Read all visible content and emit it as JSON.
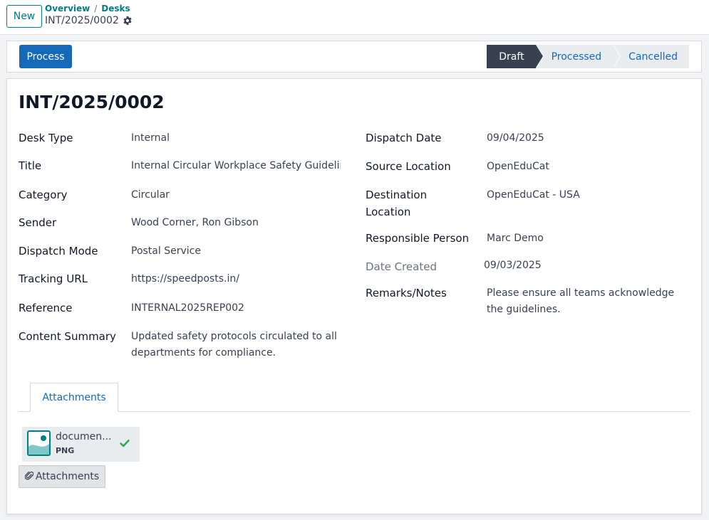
{
  "header": {
    "new_label": "New",
    "breadcrumbs": [
      "Overview",
      "Desks"
    ],
    "record_name": "INT/2025/0002"
  },
  "statusbar": {
    "process_label": "Process",
    "stages": [
      "Draft",
      "Processed",
      "Cancelled"
    ],
    "current_stage": "Draft"
  },
  "form": {
    "title": "INT/2025/0002",
    "left": [
      {
        "label": "Desk Type",
        "value": "Internal"
      },
      {
        "label": "Title",
        "value": "Internal Circular  Workplace Safety Guidelir"
      },
      {
        "label": "Category",
        "value": "Circular"
      },
      {
        "label": "Sender",
        "value": "Wood Corner, Ron Gibson"
      },
      {
        "label": "Dispatch Mode",
        "value": "Postal Service"
      },
      {
        "label": "Tracking URL",
        "value": "https://speedposts.in/"
      },
      {
        "label": "Reference",
        "value": "INTERNAL2025REP002"
      },
      {
        "label": "Content Summary",
        "value_lines": [
          "Updated safety protocols circulated to all",
          "departments for compliance."
        ]
      }
    ],
    "right": [
      {
        "label": "Dispatch Date",
        "value": "09/04/2025"
      },
      {
        "label": "Source Location",
        "value": "OpenEduCat"
      },
      {
        "label_lines": [
          "Destination",
          "Location"
        ],
        "value": "OpenEduCat - USA"
      },
      {
        "label": "Responsible Person",
        "value": "Marc Demo"
      },
      {
        "label": "Date Created",
        "value": "09/03/2025"
      },
      {
        "label": "Remarks/Notes",
        "value_lines": [
          "Please ensure all teams acknowledge",
          "the guidelines."
        ]
      }
    ]
  },
  "tabs": {
    "attachments_label": "Attachments"
  },
  "attachment": {
    "name": "documen...",
    "ext": "PNG"
  },
  "attachments_button": "Attachments",
  "colors": {
    "primary": "#1668b8",
    "teal": "#017e84",
    "stage_current": "#374151",
    "success": "#28a745"
  }
}
